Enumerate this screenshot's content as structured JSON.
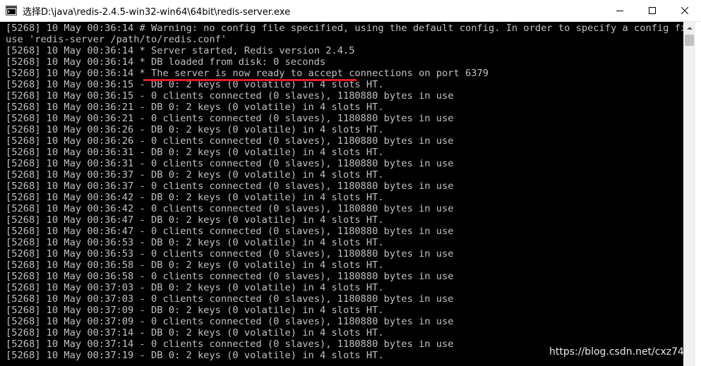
{
  "window": {
    "title": "选择D:\\java\\redis-2.4.5-win32-win64\\64bit\\redis-server.exe",
    "minimize_glyph": "—",
    "maximize_glyph": "☐",
    "close_glyph": "✕"
  },
  "console": {
    "lines": [
      "[5268] 10 May 00:36:14 # Warning: no config file specified, using the default config. In order to specify a config file",
      "use 'redis-server /path/to/redis.conf'",
      "[5268] 10 May 00:36:14 * Server started, Redis version 2.4.5",
      "[5268] 10 May 00:36:14 * DB loaded from disk: 0 seconds",
      "[5268] 10 May 00:36:14 * The server is now ready to accept connections on port 6379",
      "[5268] 10 May 00:36:15 - DB 0: 2 keys (0 volatile) in 4 slots HT.",
      "[5268] 10 May 00:36:15 - 0 clients connected (0 slaves), 1180880 bytes in use",
      "[5268] 10 May 00:36:21 - DB 0: 2 keys (0 volatile) in 4 slots HT.",
      "[5268] 10 May 00:36:21 - 0 clients connected (0 slaves), 1180880 bytes in use",
      "[5268] 10 May 00:36:26 - DB 0: 2 keys (0 volatile) in 4 slots HT.",
      "[5268] 10 May 00:36:26 - 0 clients connected (0 slaves), 1180880 bytes in use",
      "[5268] 10 May 00:36:31 - DB 0: 2 keys (0 volatile) in 4 slots HT.",
      "[5268] 10 May 00:36:31 - 0 clients connected (0 slaves), 1180880 bytes in use",
      "[5268] 10 May 00:36:37 - DB 0: 2 keys (0 volatile) in 4 slots HT.",
      "[5268] 10 May 00:36:37 - 0 clients connected (0 slaves), 1180880 bytes in use",
      "[5268] 10 May 00:36:42 - DB 0: 2 keys (0 volatile) in 4 slots HT.",
      "[5268] 10 May 00:36:42 - 0 clients connected (0 slaves), 1180880 bytes in use",
      "[5268] 10 May 00:36:47 - DB 0: 2 keys (0 volatile) in 4 slots HT.",
      "[5268] 10 May 00:36:47 - 0 clients connected (0 slaves), 1180880 bytes in use",
      "[5268] 10 May 00:36:53 - DB 0: 2 keys (0 volatile) in 4 slots HT.",
      "[5268] 10 May 00:36:53 - 0 clients connected (0 slaves), 1180880 bytes in use",
      "[5268] 10 May 00:36:58 - DB 0: 2 keys (0 volatile) in 4 slots HT.",
      "[5268] 10 May 00:36:58 - 0 clients connected (0 slaves), 1180880 bytes in use",
      "[5268] 10 May 00:37:03 - DB 0: 2 keys (0 volatile) in 4 slots HT.",
      "[5268] 10 May 00:37:03 - 0 clients connected (0 slaves), 1180880 bytes in use",
      "[5268] 10 May 00:37:09 - DB 0: 2 keys (0 volatile) in 4 slots HT.",
      "[5268] 10 May 00:37:09 - 0 clients connected (0 slaves), 1180880 bytes in use",
      "[5268] 10 May 00:37:14 - DB 0: 2 keys (0 volatile) in 4 slots HT.",
      "[5268] 10 May 00:37:14 - 0 clients connected (0 slaves), 1180880 bytes in use",
      "[5268] 10 May 00:37:19 - DB 0: 2 keys (0 volatile) in 4 slots HT."
    ]
  },
  "watermark": {
    "text": "https://blog.csdn.net/cxz74"
  },
  "colors": {
    "console_text": "#c0c0c0",
    "console_bg": "#000000",
    "highlight_underline": "#e0201c"
  },
  "icons": {
    "app": "console-app-icon",
    "minimize": "minimize-icon",
    "maximize": "maximize-icon",
    "close": "close-icon",
    "scroll_up": "chevron-up-icon"
  }
}
